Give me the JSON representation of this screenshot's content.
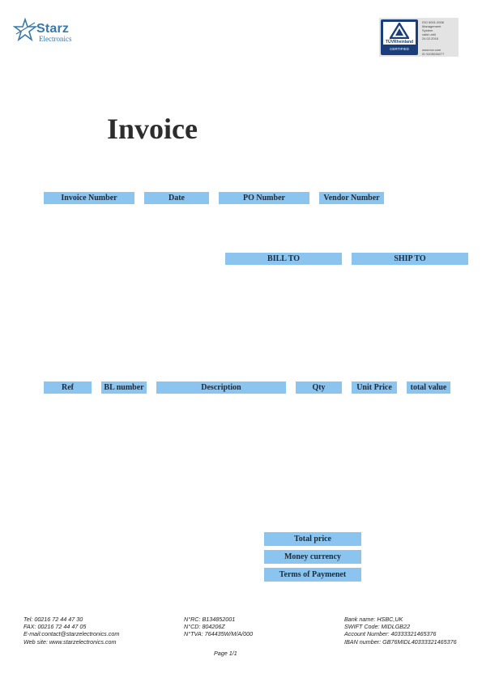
{
  "logo": {
    "brand": "Starz",
    "sub": "Electronics"
  },
  "cert": {
    "brand": "TÜVRheinland",
    "badge": "CERTIFIED",
    "lines": [
      "ISO 9001:2008",
      "Management",
      "System",
      "valid until",
      "24.02.2016"
    ],
    "lines2": [
      "www.tuv.com",
      "ID 9105036277"
    ]
  },
  "title": "Invoice",
  "invoice_headers": [
    "Invoice Number",
    "Date",
    "PO Number",
    "Vendor Number"
  ],
  "address_headers": [
    "BILL TO",
    "SHIP TO"
  ],
  "item_headers": [
    "Ref",
    "BL number",
    "Description",
    "Qty",
    "Unit Price",
    "total value"
  ],
  "totals_labels": [
    "Total price",
    "Money currency",
    "Terms of Paymenet"
  ],
  "footer": {
    "contact": [
      "Tel: 00216 72 44 47 30",
      "FAX: 00216 72 44 47 05",
      "E-mail:contact@starzelectronics.com",
      "Web site: www.starzelectronics.com"
    ],
    "registry": [
      "N°RC: B134852001",
      "N°CD: 804206Z",
      "N°TVA:  764435W/M/A/000"
    ],
    "bank": [
      "Bank name: HSBC,UK",
      "SWIFT Code: MIDLGB22",
      "Account Number: 40333321465376",
      "IBAN number: GB76MIDL40333321465376"
    ]
  },
  "page": "Page 1/1",
  "colors": {
    "header_fill": "#8ac4ef",
    "logo_blue": "#3a78a8",
    "cert_navy": "#1b3e7a"
  }
}
